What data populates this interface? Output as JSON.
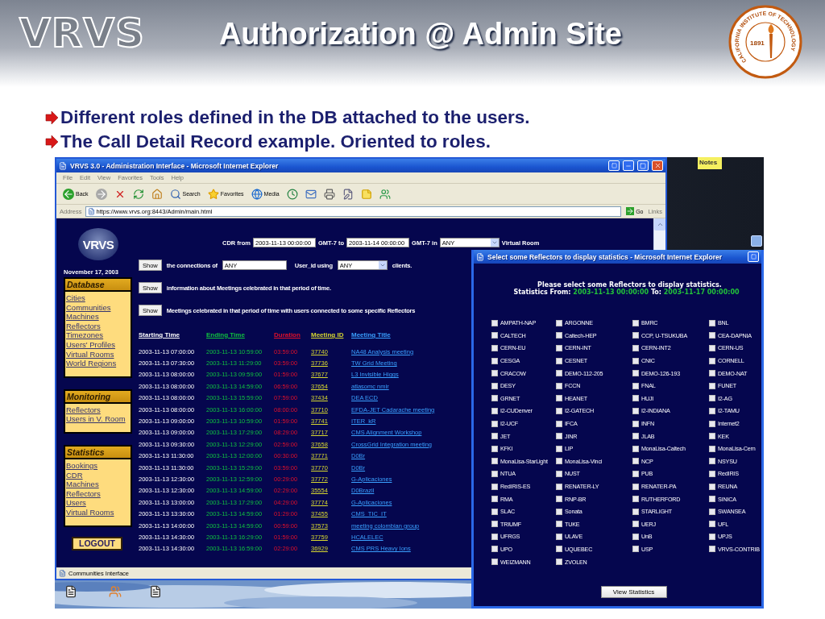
{
  "slide": {
    "logo": "VRVS",
    "title": "Authorization @ Admin Site",
    "seal": {
      "ring_text": "CALIFORNIA INSTITUTE OF TECHNOLOGY",
      "year": "1891"
    }
  },
  "bullets": [
    "Different roles defined in the DB attached to the users.",
    "The Call Detail Record example. Oriented to roles."
  ],
  "browser": {
    "title": "VRVS 3.0 - Administration Interface - Microsoft Internet Explorer",
    "menu": [
      "File",
      "Edit",
      "View",
      "Favorites",
      "Tools",
      "Help"
    ],
    "toolbar": [
      {
        "kind": "back",
        "label": "Back"
      },
      {
        "kind": "forward"
      },
      {
        "kind": "stop"
      },
      {
        "kind": "refresh"
      },
      {
        "kind": "home"
      },
      {
        "kind": "search",
        "label": "Search"
      },
      {
        "kind": "favorites",
        "label": "Favorites"
      },
      {
        "kind": "media",
        "label": "Media"
      },
      {
        "kind": "history"
      },
      {
        "kind": "mail"
      },
      {
        "kind": "print"
      },
      {
        "kind": "edit"
      },
      {
        "kind": "notes"
      },
      {
        "kind": "messenger"
      }
    ],
    "address_label": "Address",
    "url": "https://www.vrvs.org:8443/Admin/main.html",
    "go": "Go",
    "links": "Links",
    "status": "Communities Interface"
  },
  "page": {
    "logo": "VRVS",
    "date": "November 17, 2003",
    "cdr_row": {
      "label_from": "CDR from",
      "from": "2003-11-13 00:00:00",
      "label_to": "GMT-7 to",
      "to": "2003-11-14 00:00:00",
      "label_in": "GMT-7 in",
      "room": "ANY",
      "label_room": "Virtual Room"
    },
    "queries": [
      {
        "kind": "connections",
        "button": "Show",
        "text": "the connections of",
        "user": "ANY",
        "user_label": "User_id using",
        "client": "ANY",
        "client_label": "clients."
      },
      {
        "kind": "plain",
        "button": "Show",
        "text": "information about Meetings celebrated in that period of time."
      },
      {
        "kind": "plain",
        "button": "Show",
        "text": "Meetings celebrated in that period of time with users connected to some specific Reflectors"
      }
    ],
    "sidebar": [
      {
        "title": "Database",
        "links": [
          "Cities",
          "Communities",
          "Machines",
          "Reflectors",
          "Timezones",
          "Users' Profiles",
          "Virtual Rooms",
          "World Regions"
        ]
      },
      {
        "title": "Monitoring",
        "links": [
          "Reflectors",
          "Users in V. Room"
        ]
      },
      {
        "title": "Statistics",
        "links": [
          "Bookings",
          "CDR",
          "Machines",
          "Reflectors",
          "Users",
          "Virtual Rooms"
        ]
      }
    ],
    "logout": "LOGOUT",
    "table": {
      "columns": [
        {
          "label": "Starting Time",
          "color": "#ffffff"
        },
        {
          "label": "Ending Time",
          "color": "#10c040"
        },
        {
          "label": "Duration",
          "color": "#e0102a"
        },
        {
          "label": "Meeting ID",
          "color": "#d8d830"
        },
        {
          "label": "Meeting Title",
          "color": "#3aa0ff"
        }
      ],
      "rows": [
        [
          "2003-11-13 07:00:00",
          "2003-11-13 10:59:00",
          "03:59:00",
          "37740",
          "NA48 Analysis meeting"
        ],
        [
          "2003-11-13 07:30:00",
          "2003-11-13 11:29:00",
          "03:59:00",
          "37736",
          "TW Grid Meeting"
        ],
        [
          "2003-11-13 08:00:00",
          "2003-11-13 09:59:00",
          "01:59:00",
          "37677",
          "L3 Invisible Higgs"
        ],
        [
          "2003-11-13 08:00:00",
          "2003-11-13 14:59:00",
          "06:59:00",
          "37654",
          "atlasomc nmir"
        ],
        [
          "2003-11-13 08:00:00",
          "2003-11-13 15:59:00",
          "07:59:00",
          "37434",
          "DEA ECD"
        ],
        [
          "2003-11-13 08:00:00",
          "2003-11-13 16:00:00",
          "08:00:00",
          "37710",
          "EFDA-JET Cadarache meeting"
        ],
        [
          "2003-11-13 09:00:00",
          "2003-11-13 10:59:00",
          "01:59:00",
          "37741",
          "ITER_kR"
        ],
        [
          "2003-11-13 09:00:00",
          "2003-11-13 17:29:00",
          "08:29:00",
          "37717",
          "CMS Alignment Workshop"
        ],
        [
          "2003-11-13 09:30:00",
          "2003-11-13 12:29:00",
          "02:59:00",
          "37658",
          "CrossGrid Integration meeting"
        ],
        [
          "2003-11-13 11:30:00",
          "2003-11-13 12:00:00",
          "00:30:00",
          "37771",
          "D0Br"
        ],
        [
          "2003-11-13 11:30:00",
          "2003-11-13 15:29:00",
          "03:59:00",
          "37770",
          "D0Br"
        ],
        [
          "2003-11-13 12:30:00",
          "2003-11-13 12:59:00",
          "00:29:00",
          "37772",
          "G-Aplicaciones"
        ],
        [
          "2003-11-13 12:30:00",
          "2003-11-13 14:59:00",
          "02:29:00",
          "35554",
          "D0Brazil"
        ],
        [
          "2003-11-13 13:00:00",
          "2003-11-13 17:29:00",
          "04:29:00",
          "37774",
          "G-Aplicaciones"
        ],
        [
          "2003-11-13 13:30:00",
          "2003-11-13 14:59:00",
          "01:29:00",
          "37455",
          "CMS_TIC_IT"
        ],
        [
          "2003-11-13 14:00:00",
          "2003-11-13 14:59:00",
          "00:59:00",
          "37573",
          "meeting colombian group"
        ],
        [
          "2003-11-13 14:30:00",
          "2003-11-13 16:29:00",
          "01:59:00",
          "37759",
          "HCALELEC"
        ],
        [
          "2003-11-13 14:30:00",
          "2003-11-13 16:59:00",
          "02:29:00",
          "36929",
          "CMS PRS Heavy Ions"
        ]
      ]
    }
  },
  "popup": {
    "title": "Select some Reflectors to display statistics - Microsoft Internet Explorer",
    "heading": "Please select some Reflectors to display statistics.",
    "from_label": "Statistics From:",
    "from": "2003-11-13 00:00:00",
    "to_label": "To:",
    "to": "2003-11-17 00:00:00",
    "reflectors": [
      {
        "name": "AMPATH-NAP",
        "checked": false
      },
      {
        "name": "ARGONNE",
        "checked": false
      },
      {
        "name": "BMRC",
        "checked": false
      },
      {
        "name": "BNL",
        "checked": false
      },
      {
        "name": "CALTECH",
        "checked": false
      },
      {
        "name": "Caltech-HEP",
        "checked": false
      },
      {
        "name": "CCP, U-TSUKUBA",
        "checked": false
      },
      {
        "name": "CEA-DAPNIA",
        "checked": false
      },
      {
        "name": "CERN-EU",
        "checked": false
      },
      {
        "name": "CERN-INT",
        "checked": false
      },
      {
        "name": "CERN-INT2",
        "checked": false
      },
      {
        "name": "CERN-US",
        "checked": false
      },
      {
        "name": "CESGA",
        "checked": false
      },
      {
        "name": "CESNET",
        "checked": false
      },
      {
        "name": "CNIC",
        "checked": false
      },
      {
        "name": "CORNELL",
        "checked": false
      },
      {
        "name": "CRACOW",
        "checked": false
      },
      {
        "name": "DEMO-112-205",
        "checked": false
      },
      {
        "name": "DEMO-126-193",
        "checked": false
      },
      {
        "name": "DEMO-NAT",
        "checked": false
      },
      {
        "name": "DESY",
        "checked": false
      },
      {
        "name": "FCCN",
        "checked": false
      },
      {
        "name": "FNAL",
        "checked": false
      },
      {
        "name": "FUNET",
        "checked": false
      },
      {
        "name": "GRNET",
        "checked": false
      },
      {
        "name": "HEANET",
        "checked": false
      },
      {
        "name": "HUJI",
        "checked": false
      },
      {
        "name": "I2-AG",
        "checked": false
      },
      {
        "name": "I2-CUDenver",
        "checked": false
      },
      {
        "name": "I2-GATECH",
        "checked": false
      },
      {
        "name": "I2-INDIANA",
        "checked": false
      },
      {
        "name": "I2-TAMU",
        "checked": false
      },
      {
        "name": "I2-UCF",
        "checked": false
      },
      {
        "name": "IFCA",
        "checked": false
      },
      {
        "name": "INFN",
        "checked": false
      },
      {
        "name": "Internet2",
        "checked": false
      },
      {
        "name": "JET",
        "checked": false
      },
      {
        "name": "JINR",
        "checked": false
      },
      {
        "name": "JLAB",
        "checked": false
      },
      {
        "name": "KEK",
        "checked": false
      },
      {
        "name": "KFKI",
        "checked": false
      },
      {
        "name": "LIP",
        "checked": false
      },
      {
        "name": "MonaLisa-Caltech",
        "checked": false
      },
      {
        "name": "MonaLisa-Cern",
        "checked": false
      },
      {
        "name": "MonaLisa-StarLight",
        "checked": false
      },
      {
        "name": "MonaLisa-Vinci",
        "checked": false
      },
      {
        "name": "NCP",
        "checked": false
      },
      {
        "name": "NSYSU",
        "checked": false
      },
      {
        "name": "NTUA",
        "checked": false
      },
      {
        "name": "NUST",
        "checked": false
      },
      {
        "name": "PUB",
        "checked": false
      },
      {
        "name": "RedIRIS",
        "checked": false
      },
      {
        "name": "RedIRIS-ES",
        "checked": false
      },
      {
        "name": "RENATER-LY",
        "checked": false
      },
      {
        "name": "RENATER-PA",
        "checked": false
      },
      {
        "name": "REUNA",
        "checked": false
      },
      {
        "name": "RMA",
        "checked": false
      },
      {
        "name": "RNP-BR",
        "checked": false
      },
      {
        "name": "RUTHERFORD",
        "checked": false
      },
      {
        "name": "SINICA",
        "checked": false
      },
      {
        "name": "SLAC",
        "checked": false
      },
      {
        "name": "Sonata",
        "checked": false
      },
      {
        "name": "STARLIGHT",
        "checked": false
      },
      {
        "name": "SWANSEA",
        "checked": false
      },
      {
        "name": "TRIUMF",
        "checked": false
      },
      {
        "name": "TUKE",
        "checked": false
      },
      {
        "name": "UERJ",
        "checked": false
      },
      {
        "name": "UFL",
        "checked": false
      },
      {
        "name": "UFRGS",
        "checked": false
      },
      {
        "name": "ULAVE",
        "checked": false
      },
      {
        "name": "UnB",
        "checked": false
      },
      {
        "name": "UPJS",
        "checked": false
      },
      {
        "name": "UPO",
        "checked": false
      },
      {
        "name": "UQUEBEC",
        "checked": false
      },
      {
        "name": "USP",
        "checked": false
      },
      {
        "name": "VRVS-CONTRIB",
        "checked": false
      },
      {
        "name": "WEIZMANN",
        "checked": false
      },
      {
        "name": "ZVOLEN",
        "checked": false
      }
    ],
    "button": "View Statistics"
  },
  "desktop": {
    "notes": "Notes"
  }
}
